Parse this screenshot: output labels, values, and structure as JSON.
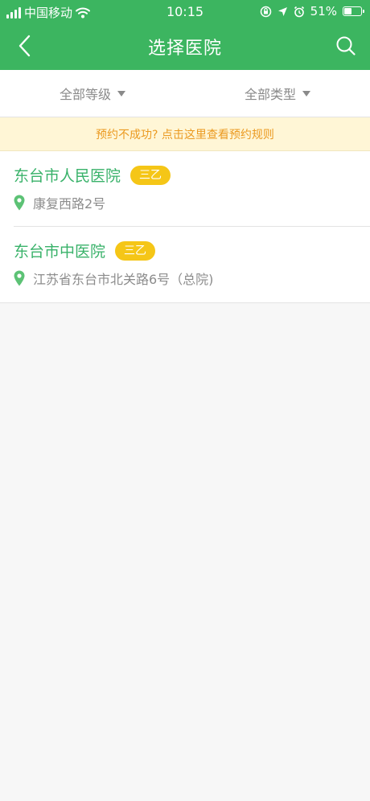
{
  "status_bar": {
    "carrier": "中国移动",
    "time": "10:15",
    "battery_percent": "51%",
    "battery_level": 0.51,
    "icons": [
      "signal-icon",
      "wifi-icon",
      "lock-rotation-icon",
      "location-arrow-icon",
      "alarm-icon",
      "battery-icon"
    ]
  },
  "nav": {
    "title": "选择医院",
    "back_icon": "chevron-left-icon",
    "search_icon": "search-icon"
  },
  "filters": {
    "level_label": "全部等级",
    "type_label": "全部类型"
  },
  "notice": {
    "text": "预约不成功? 点击这里查看预约规则"
  },
  "hospitals": [
    {
      "name": "东台市人民医院",
      "level": "三乙",
      "address": "康复西路2号"
    },
    {
      "name": "东台市中医院",
      "level": "三乙",
      "address": "江苏省东台市北关路6号（总院)"
    }
  ],
  "colors": {
    "header_green": "#3cb560",
    "name_green": "#39b26a",
    "badge_yellow": "#f5c617",
    "notice_bg": "#fff6d6",
    "notice_text": "#eb9a21",
    "page_bg": "#f7f7f7"
  }
}
